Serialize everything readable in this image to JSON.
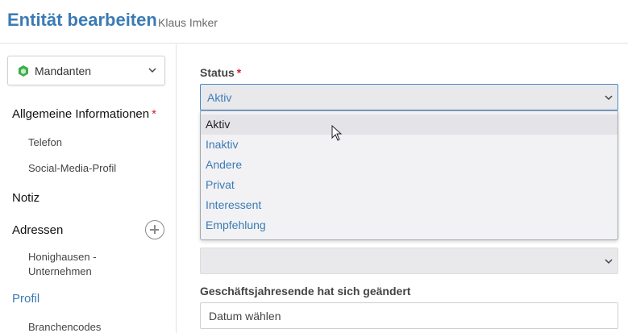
{
  "header": {
    "title": "Entität bearbeiten",
    "subtitle": "Klaus Imker"
  },
  "sidebar": {
    "selector_label": "Mandanten",
    "items": [
      {
        "label": "Allgemeine Informationen",
        "required_mark": "*"
      },
      {
        "label": "Telefon"
      },
      {
        "label": "Social-Media-Profil"
      },
      {
        "label": "Notiz"
      },
      {
        "label": "Adressen"
      },
      {
        "label": "Honighausen - Unternehmen"
      },
      {
        "label": "Profil",
        "active": true
      },
      {
        "label": "Branchencodes"
      }
    ]
  },
  "main": {
    "status_label": "Status",
    "status_required_mark": "*",
    "status_value": "Aktiv",
    "status_options": [
      "Aktiv",
      "Inaktiv",
      "Andere",
      "Privat",
      "Interessent",
      "Empfehlung"
    ],
    "fiscal_change_label": "Geschäftsjahresende hat sich geändert",
    "date_placeholder": "Datum wählen"
  },
  "colors": {
    "accent": "#3b7bb5",
    "required": "#d0262b",
    "mandant_icon": "#3fae49"
  },
  "icons": {
    "mandant": "hexagon-icon",
    "chevron": "chevron-down-icon",
    "add": "plus-circle-icon",
    "cursor": "mouse-pointer-icon"
  }
}
